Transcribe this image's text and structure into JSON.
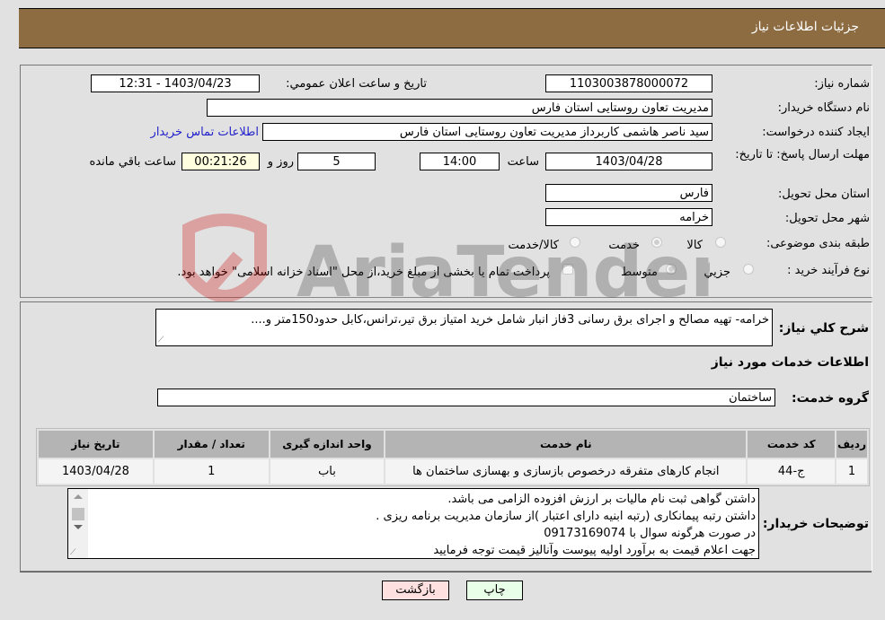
{
  "header": {
    "title": "جزئیات اطلاعات نیاز"
  },
  "form": {
    "need_number_label": "شماره نیاز:",
    "need_number": "1103003878000072",
    "announce_label": "تاریخ و ساعت اعلان عمومي:",
    "announce_value": "1403/04/23 - 12:31",
    "buyer_org_label": "نام دستگاه خریدار:",
    "buyer_org": "مدیریت تعاون روستایی استان فارس",
    "creator_label": "ایجاد کننده درخواست:",
    "creator": "سید ناصر هاشمی کاربرداز مدیریت تعاون روستایی استان فارس",
    "contact_link": "اطلاعات تماس خریدار",
    "deadline_label": "مهلت ارسال پاسخ: تا تاریخ:",
    "deadline_date": "1403/04/28",
    "time_label": "ساعت",
    "deadline_time": "14:00",
    "days": "5",
    "days_label": "روز و",
    "remaining": "00:21:26",
    "remaining_label": "ساعت باقي مانده",
    "province_label": "استان محل تحویل:",
    "province": "فارس",
    "city_label": "شهر محل تحویل:",
    "city": "خرامه",
    "category_label": "طبقه بندی موضوعی:",
    "category_options": [
      "کالا",
      "خدمت",
      "کالا/خدمت"
    ],
    "category_selected": "خدمت",
    "process_label": "نوع فرآیند خرید :",
    "process_options": [
      "جزيي",
      "متوسط"
    ],
    "process_selected": "متوسط",
    "payment_note": "پرداخت تمام یا بخشی از مبلغ خرید،از محل \"اسناد خزانه اسلامی\" خواهد بود."
  },
  "description": {
    "label": "شرح کلي نیاز:",
    "text": "خرامه- تهیه مصالح و اجرای برق رسانی 3فاز انبار شامل خرید امتیاز برق تیر،ترانس،کابل حدود150متر و...."
  },
  "services": {
    "section_title": "اطلاعات خدمات مورد نیاز",
    "group_label": "گروه خدمت:",
    "group_value": "ساختمان",
    "columns": [
      "ردیف",
      "کد خدمت",
      "نام خدمت",
      "واحد اندازه گیری",
      "تعداد / مقدار",
      "تاریخ نیاز"
    ],
    "rows": [
      [
        "1",
        "ج-44",
        "انجام کارهای متفرقه درخصوص بازسازی و بهسازی ساختمان ها",
        "باب",
        "1",
        "1403/04/28"
      ]
    ]
  },
  "buyer_notes": {
    "label": "توضیحات خریدار:",
    "lines": [
      "داشتن گواهی ثبت نام مالیات بر ارزش افزوده الزامی می باشد.",
      "داشتن رتبه پیمانکاری (رتبه ابنیه دارای اعتبار )از سازمان مدیریت برنامه ریزی .",
      "در صورت هرگونه سوال با 09173169074",
      "جهت اعلام قیمت به برآورد اولیه پیوست وآنالیز قیمت توجه فرمایید"
    ]
  },
  "buttons": {
    "print": "چاپ",
    "back": "بازگشت"
  },
  "watermark": {
    "text": "AriaTender.net"
  }
}
